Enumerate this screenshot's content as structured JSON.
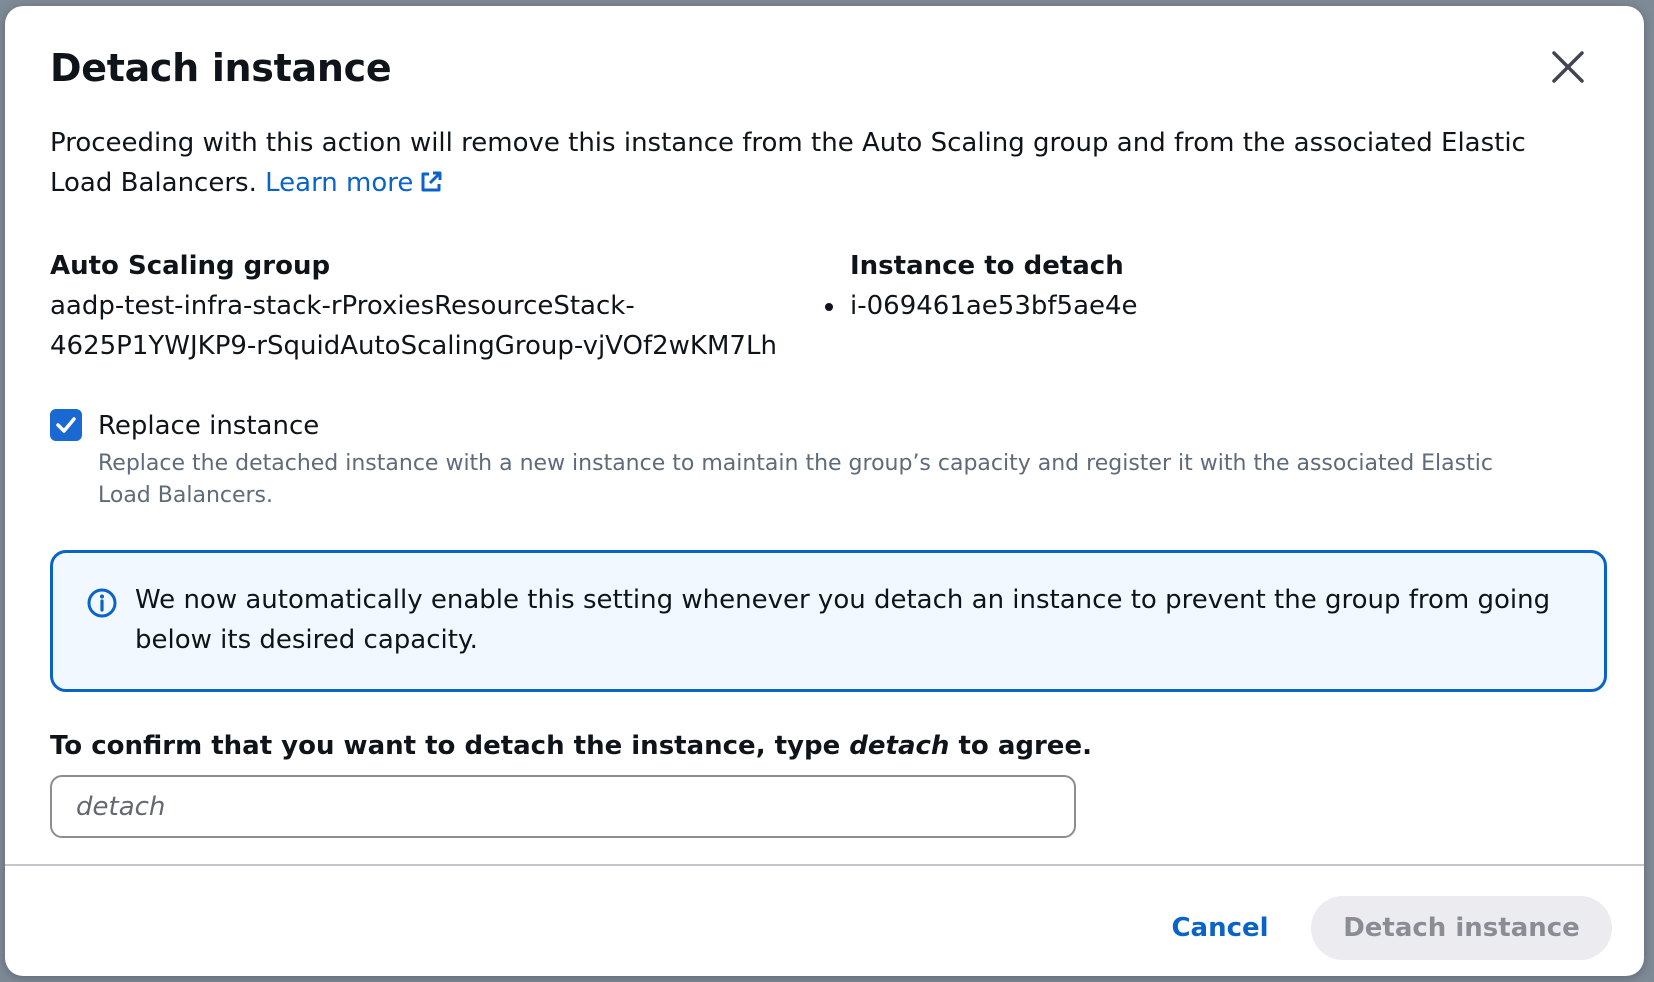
{
  "modal": {
    "title": "Detach instance",
    "description": "Proceeding with this action will remove this instance from the Auto Scaling group and from the associated Elastic Load Balancers.",
    "learn_more": "Learn more"
  },
  "details": {
    "asg_label": "Auto Scaling group",
    "asg_value": "aadp-test-infra-stack-rProxiesResourceStack-4625P1YWJKP9-rSquidAutoScalingGroup-vjVOf2wKM7Lh",
    "instance_label": "Instance to detach",
    "instances": [
      "i-069461ae53bf5ae4e"
    ]
  },
  "replace": {
    "checked": true,
    "label": "Replace instance",
    "description": "Replace the detached instance with a new instance to maintain the group’s capacity and register it with the associated Elastic Load Balancers."
  },
  "info": {
    "icon": "info-icon",
    "text": "We now automatically enable this setting whenever you detach an instance to prevent the group from going below its desired capacity."
  },
  "confirm": {
    "label_prefix": "To confirm that you want to detach the instance, type ",
    "label_keyword": "detach",
    "label_suffix": " to agree.",
    "placeholder": "detach",
    "value": ""
  },
  "footer": {
    "cancel_label": "Cancel",
    "detach_label": "Detach instance"
  },
  "colors": {
    "accent": "#0a64c8",
    "info_bg": "#f1f8ff",
    "disabled_bg": "#ebebf0",
    "disabled_text": "#8c8c94"
  }
}
